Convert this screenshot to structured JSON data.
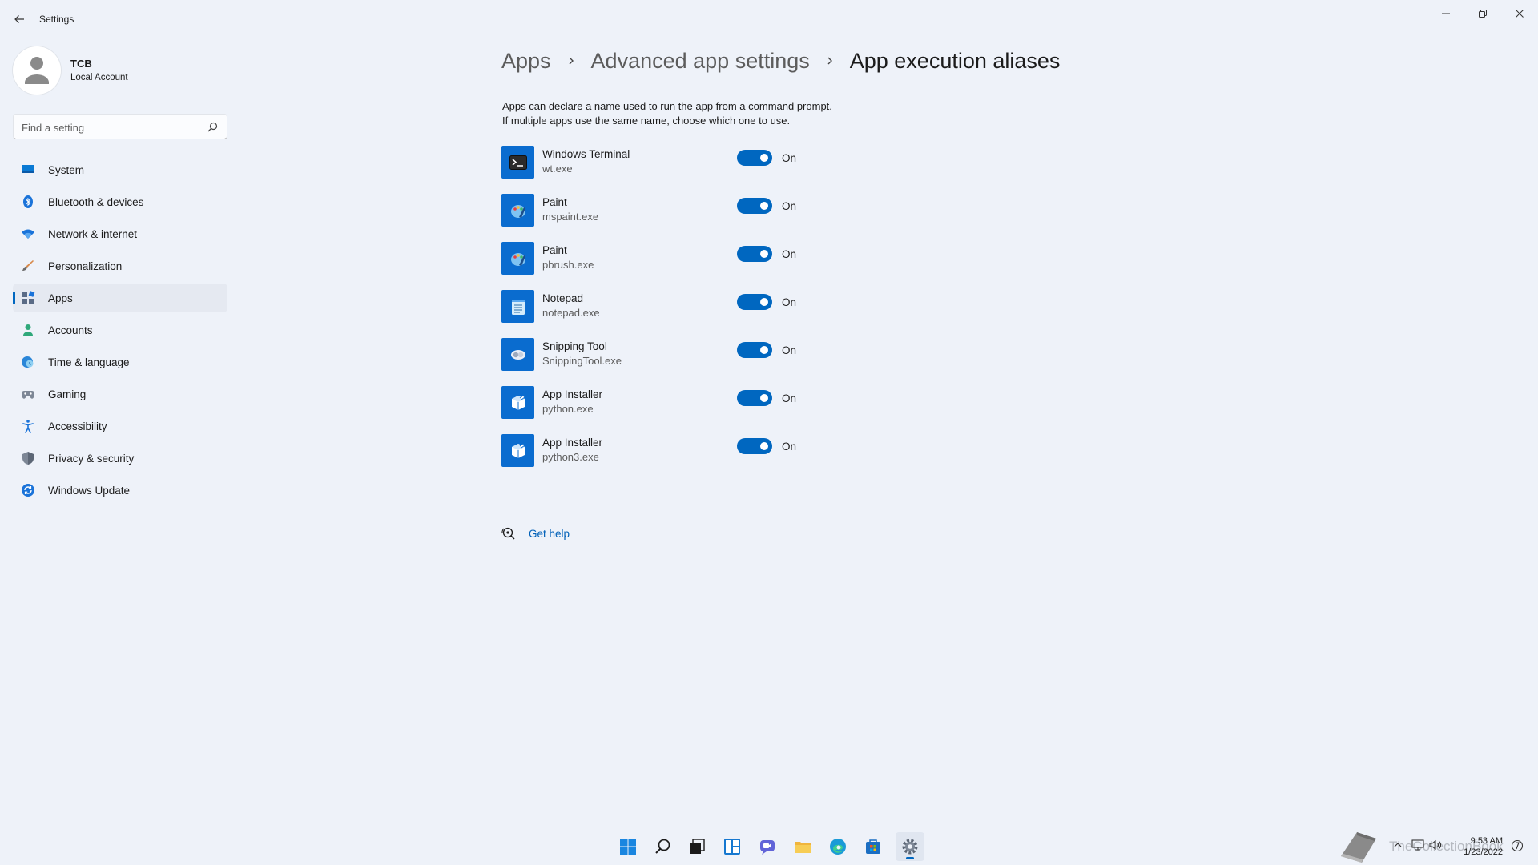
{
  "window": {
    "title": "Settings"
  },
  "profile": {
    "name": "TCB",
    "account_type": "Local Account"
  },
  "search": {
    "placeholder": "Find a setting"
  },
  "sidebar": {
    "items": [
      {
        "label": "System",
        "icon": "monitor-icon",
        "selected": false
      },
      {
        "label": "Bluetooth & devices",
        "icon": "bluetooth-icon",
        "selected": false
      },
      {
        "label": "Network & internet",
        "icon": "wifi-icon",
        "selected": false
      },
      {
        "label": "Personalization",
        "icon": "brush-icon",
        "selected": false
      },
      {
        "label": "Apps",
        "icon": "apps-icon",
        "selected": true
      },
      {
        "label": "Accounts",
        "icon": "person-icon",
        "selected": false
      },
      {
        "label": "Time & language",
        "icon": "globe-clock-icon",
        "selected": false
      },
      {
        "label": "Gaming",
        "icon": "gamepad-icon",
        "selected": false
      },
      {
        "label": "Accessibility",
        "icon": "accessibility-icon",
        "selected": false
      },
      {
        "label": "Privacy & security",
        "icon": "shield-icon",
        "selected": false
      },
      {
        "label": "Windows Update",
        "icon": "update-icon",
        "selected": false
      }
    ]
  },
  "breadcrumb": {
    "items": [
      "Apps",
      "Advanced app settings",
      "App execution aliases"
    ]
  },
  "description": {
    "line1": "Apps can declare a name used to run the app from a command prompt.",
    "line2": "If multiple apps use the same name, choose which one to use."
  },
  "aliases": [
    {
      "name": "Windows Terminal",
      "exe": "wt.exe",
      "state": "On",
      "icon": "terminal-icon"
    },
    {
      "name": "Paint",
      "exe": "mspaint.exe",
      "state": "On",
      "icon": "paint-icon"
    },
    {
      "name": "Paint",
      "exe": "pbrush.exe",
      "state": "On",
      "icon": "paint-icon"
    },
    {
      "name": "Notepad",
      "exe": "notepad.exe",
      "state": "On",
      "icon": "notepad-icon"
    },
    {
      "name": "Snipping Tool",
      "exe": "SnippingTool.exe",
      "state": "On",
      "icon": "snipping-tool-icon"
    },
    {
      "name": "App Installer",
      "exe": "python.exe",
      "state": "On",
      "icon": "app-installer-icon"
    },
    {
      "name": "App Installer",
      "exe": "python3.exe",
      "state": "On",
      "icon": "app-installer-icon"
    }
  ],
  "help": {
    "label": "Get help"
  },
  "taskbar": {
    "apps": [
      "start-icon",
      "search-icon",
      "task-view-icon",
      "widgets-icon",
      "chat-icon",
      "file-explorer-icon",
      "edge-icon",
      "store-icon",
      "settings-icon"
    ],
    "watermark": "TheCollectionBook",
    "time": "9:53 AM",
    "date": "1/23/2022"
  },
  "colors": {
    "accent": "#0067c0",
    "background": "#eef2f9",
    "app_tile": "#0a6ccf"
  }
}
